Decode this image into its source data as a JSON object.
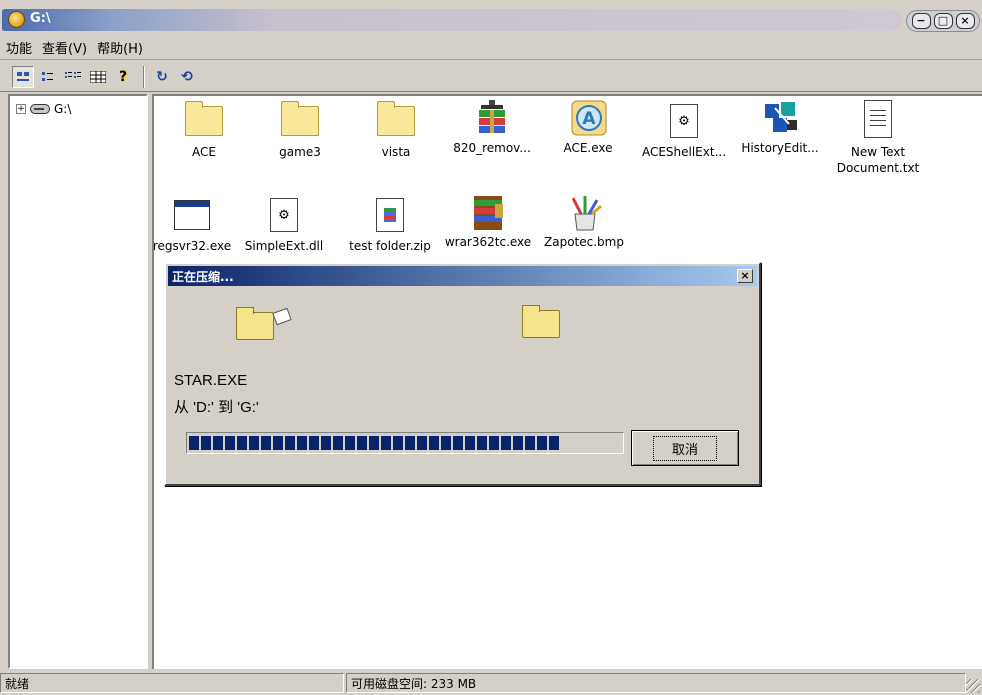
{
  "window": {
    "title": "G:\\",
    "minimize": "−",
    "maximize": "□",
    "close": "×"
  },
  "menu": [
    "功能",
    "查看(V)",
    "帮助(H)"
  ],
  "toolbar": {
    "view_icons": [
      "large-icons-icon",
      "small-icons-icon",
      "list-view-icon",
      "details-view-icon"
    ],
    "help_glyph": "?",
    "refresh_glyph": "↻",
    "sync_glyph": "⟲"
  },
  "tree": {
    "expander": "+",
    "label": "G:\\"
  },
  "files": [
    {
      "label": "ACE",
      "kind": "folder"
    },
    {
      "label": "game3",
      "kind": "folder"
    },
    {
      "label": "vista",
      "kind": "folder"
    },
    {
      "label": "820_remov...",
      "kind": "archive"
    },
    {
      "label": "ACE.exe",
      "kind": "ace"
    },
    {
      "label": "ACEShellExt...",
      "kind": "dll"
    },
    {
      "label": "HistoryEdit...",
      "kind": "cubes"
    },
    {
      "label": "New Text Document.txt",
      "kind": "text"
    },
    {
      "label": "regsvr32.exe",
      "kind": "window"
    },
    {
      "label": "SimpleExt.dll",
      "kind": "dll"
    },
    {
      "label": "test folder.zip",
      "kind": "zip"
    },
    {
      "label": "wrar362tc.exe",
      "kind": "winrar"
    },
    {
      "label": "Zapotec.bmp",
      "kind": "paint"
    }
  ],
  "dialog": {
    "title": "正在压缩...",
    "close": "×",
    "file_name": "STAR.EXE",
    "path_text": "从 'D:' 到 'G:'",
    "progress": 0.86,
    "cancel_label": "取消"
  },
  "status": {
    "left": "就绪",
    "free_space": "可用磁盘空间: 233 MB"
  },
  "colors": {
    "dialog_title": "#0a246a",
    "progress": "#0a246a",
    "folder": "#f9e79a"
  }
}
